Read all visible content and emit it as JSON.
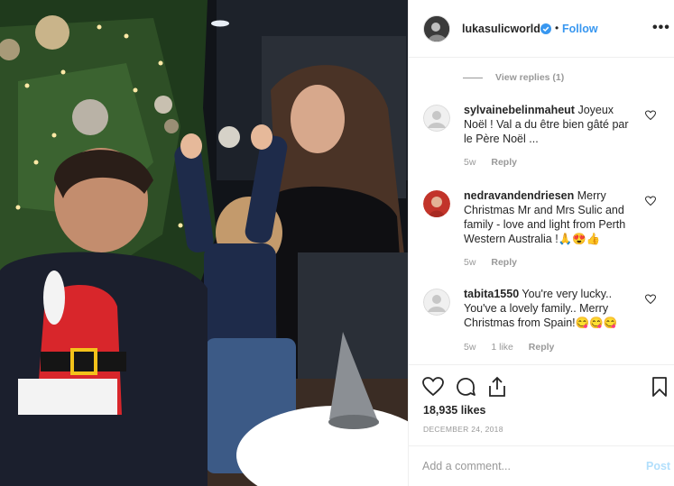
{
  "post": {
    "author": "lukasulicworld",
    "follow_label": "Follow",
    "separator": "•",
    "more_label": "•••",
    "verified_icon": "verified-badge-icon",
    "accent_color": "#3897f0"
  },
  "comments": {
    "view_replies": "View replies (1)",
    "items": [
      {
        "username": "sylvainebelinmaheut",
        "text": "Joyeux Noël ! Val a du être bien gâté par le Père Noël ...",
        "age": "5w",
        "likes": "",
        "reply": "Reply"
      },
      {
        "username": "nedravandendriesen",
        "text": "Merry Christmas Mr and Mrs Sulic and family - love and light from Perth Western Australia !🙏😍👍",
        "age": "5w",
        "likes": "",
        "reply": "Reply"
      },
      {
        "username": "tabita1550",
        "text": "You're very lucky.. You've a lovely family.. Merry Christmas from Spain!😋😋😋",
        "age": "5w",
        "likes": "1 like",
        "reply": "Reply"
      }
    ]
  },
  "actions": {
    "like_icon": "heart-icon",
    "comment_icon": "comment-icon",
    "share_icon": "share-icon",
    "save_icon": "bookmark-icon",
    "likes_count": "18,935 likes",
    "date": "DECEMBER 24, 2018"
  },
  "composer": {
    "placeholder": "Add a comment...",
    "post_label": "Post"
  }
}
